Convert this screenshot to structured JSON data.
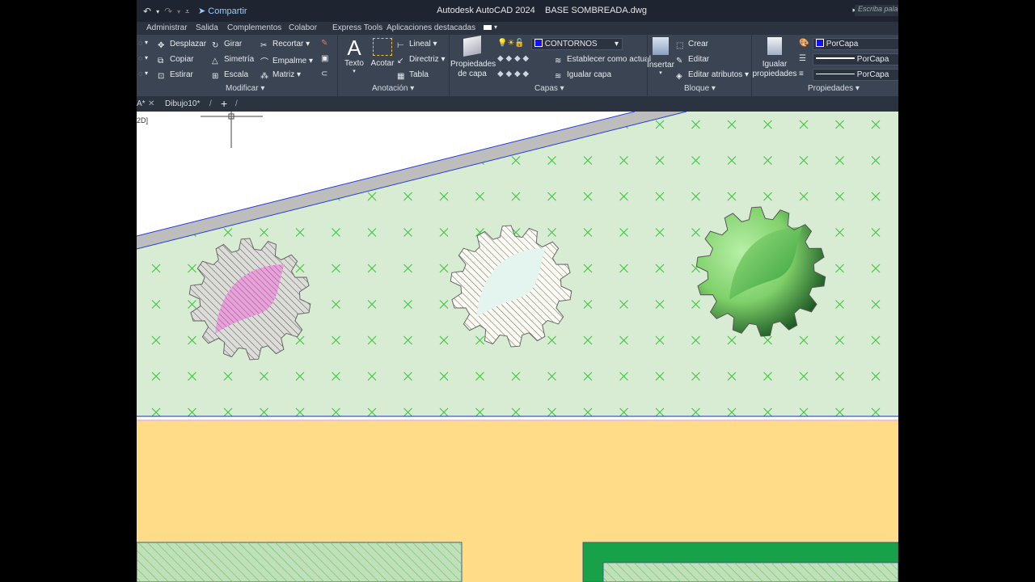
{
  "window": {
    "app_title": "Autodesk AutoCAD 2024",
    "file_name": "BASE SOMBREADA.dwg",
    "share_label": "Compartir",
    "search_placeholder": "Escriba pala"
  },
  "ribbon_tabs": [
    "Administrar",
    "Salida",
    "Complementos",
    "Colabor",
    "Express Tools",
    "Aplicaciones destacadas"
  ],
  "modify_panel": {
    "label": "Modificar",
    "items": {
      "move": "Desplazar",
      "rotate": "Girar",
      "trim": "Recortar",
      "copy": "Copiar",
      "mirror": "Simetría",
      "fillet": "Empalme",
      "stretch": "Estirar",
      "scale": "Escala",
      "array": "Matriz"
    }
  },
  "annotation_panel": {
    "label": "Anotación",
    "text": "Texto",
    "dimension": "Acotar",
    "linear": "Lineal",
    "leader": "Directriz",
    "table": "Tabla"
  },
  "layers_panel": {
    "label": "Capas",
    "layer_properties": [
      "Propiedades",
      "de capa"
    ],
    "current_layer": "CONTORNOS",
    "set_current": "Establecer como actual",
    "match_layer": "Igualar capa"
  },
  "block_panel": {
    "label": "Bloque",
    "insert": "Insertar",
    "create": "Crear",
    "edit": "Editar",
    "edit_attributes": "Editar atributos"
  },
  "properties_panel": {
    "label": "Propiedades",
    "match_properties": [
      "Igualar",
      "propiedades"
    ],
    "color": "PorCapa",
    "linetype": "PorCapa",
    "lineweight": "PorCapa"
  },
  "doc_tabs": {
    "active_fragment": "A*",
    "drawing": "Dibujo10*",
    "new_tab": "+"
  },
  "canvas": {
    "view_label": "2D]"
  },
  "colors": {
    "title_bg": "#1e2430",
    "ribbon_bg": "#3b4453",
    "lawn_fill": "#d7ebd2",
    "lawn_x": "#39c43a",
    "sand_fill": "#ffdc87",
    "hedge_green": "#17a24a",
    "boundary_blue": "#1f3fd6"
  }
}
